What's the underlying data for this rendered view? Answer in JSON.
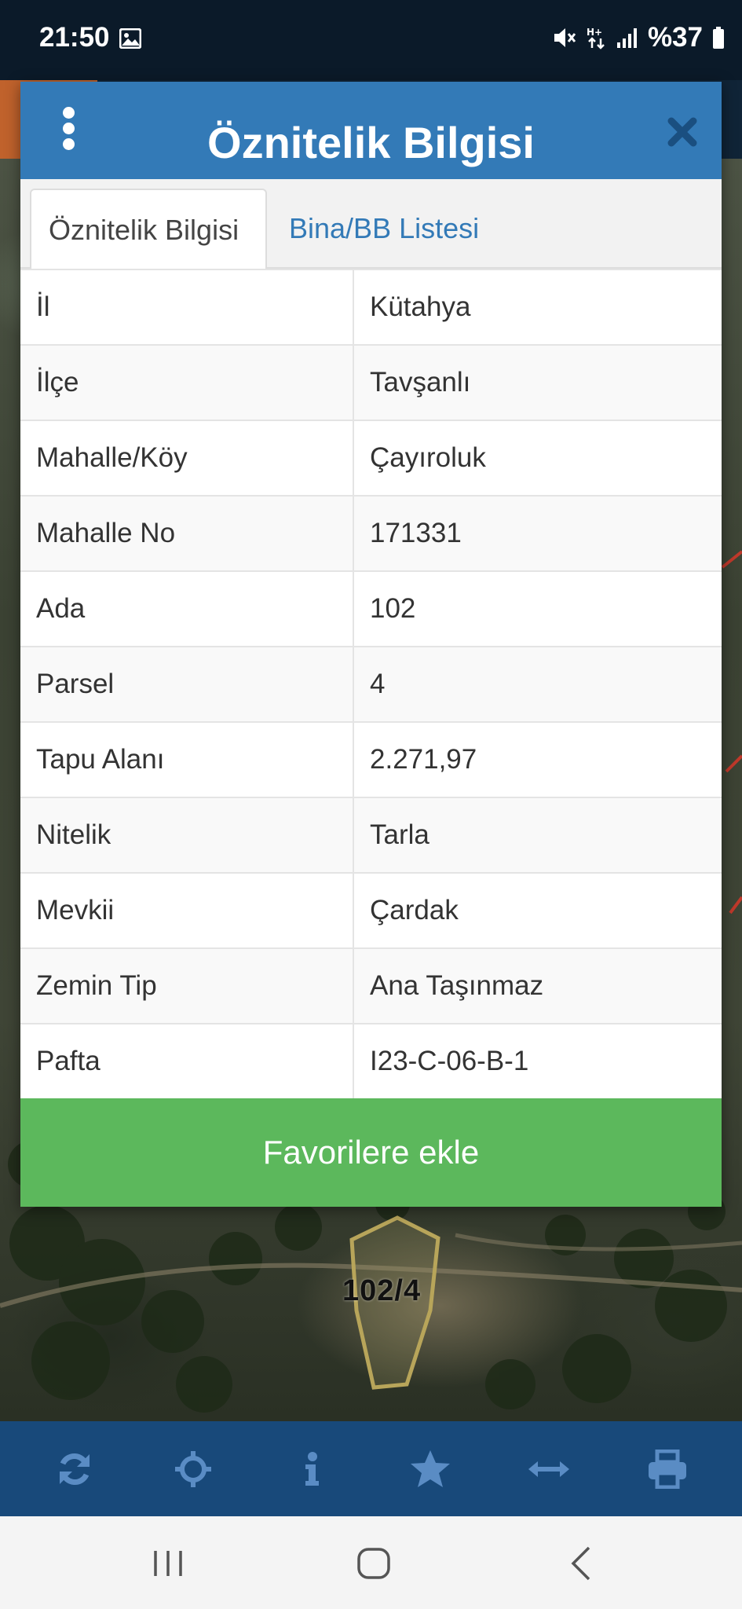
{
  "status_bar": {
    "time": "21:50",
    "battery_text": "%37",
    "icons": [
      "image-icon",
      "mute-icon",
      "data-transfer-icon",
      "signal-icon",
      "battery-icon"
    ]
  },
  "modal": {
    "title": "Öznitelik Bilgisi",
    "tabs": [
      {
        "label": "Öznitelik Bilgisi",
        "active": true
      },
      {
        "label": "Bina/BB Listesi",
        "active": false
      }
    ],
    "rows": [
      {
        "label": "İl",
        "value": "Kütahya"
      },
      {
        "label": "İlçe",
        "value": "Tavşanlı"
      },
      {
        "label": "Mahalle/Köy",
        "value": "Çayıroluk"
      },
      {
        "label": "Mahalle No",
        "value": "171331"
      },
      {
        "label": "Ada",
        "value": "102"
      },
      {
        "label": "Parsel",
        "value": "4"
      },
      {
        "label": "Tapu Alanı",
        "value": "2.271,97"
      },
      {
        "label": "Nitelik",
        "value": "Tarla"
      },
      {
        "label": "Mevkii",
        "value": "Çardak"
      },
      {
        "label": "Zemin Tip",
        "value": "Ana Taşınmaz"
      },
      {
        "label": "Pafta",
        "value": "I23-C-06-B-1"
      }
    ],
    "favorite_button": "Favorilere ekle"
  },
  "map": {
    "parcel_label": "102/4"
  },
  "toolbar": {
    "buttons": [
      "refresh-icon",
      "locate-icon",
      "info-icon",
      "star-icon",
      "measure-icon",
      "print-icon"
    ]
  },
  "colors": {
    "header_blue": "#337ab7",
    "button_green": "#5cb85c",
    "toolbar_blue": "#18497a",
    "status_bar": "#0b1a29"
  }
}
